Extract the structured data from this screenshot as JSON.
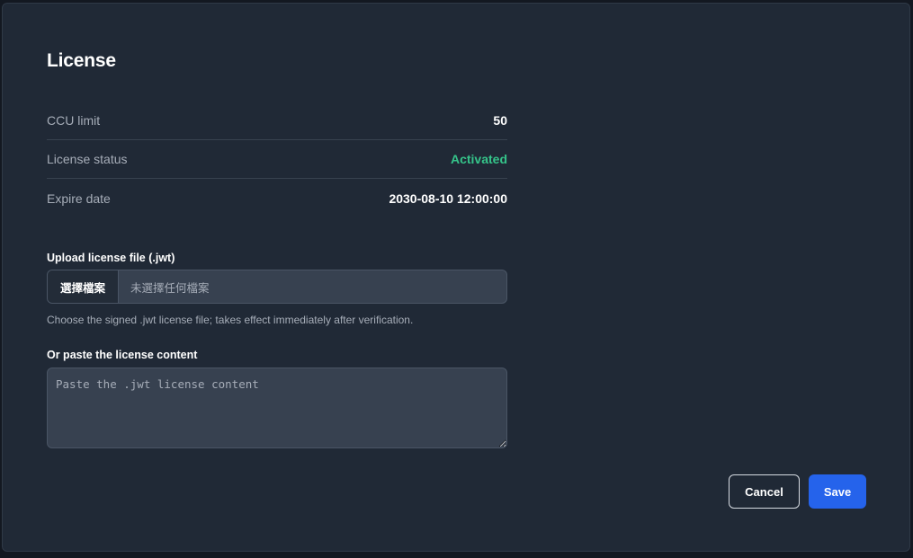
{
  "page": {
    "title": "License"
  },
  "license_info": [
    {
      "label": "CCU limit",
      "value": "50"
    },
    {
      "label": "License status",
      "value": "Activated"
    },
    {
      "label": "Expire date",
      "value": "2030-08-10 12:00:00"
    }
  ],
  "colors": {
    "status_activated": "#35c48a",
    "primary_button": "#2563eb"
  },
  "upload": {
    "label": "Upload license file (.jwt)",
    "button_label": "選擇檔案",
    "no_file_text": "未選擇任何檔案",
    "help": "Choose the signed .jwt license file; takes effect immediately after verification."
  },
  "paste": {
    "label": "Or paste the license content",
    "placeholder": "Paste the .jwt license content",
    "value": ""
  },
  "actions": {
    "cancel_label": "Cancel",
    "save_label": "Save"
  }
}
